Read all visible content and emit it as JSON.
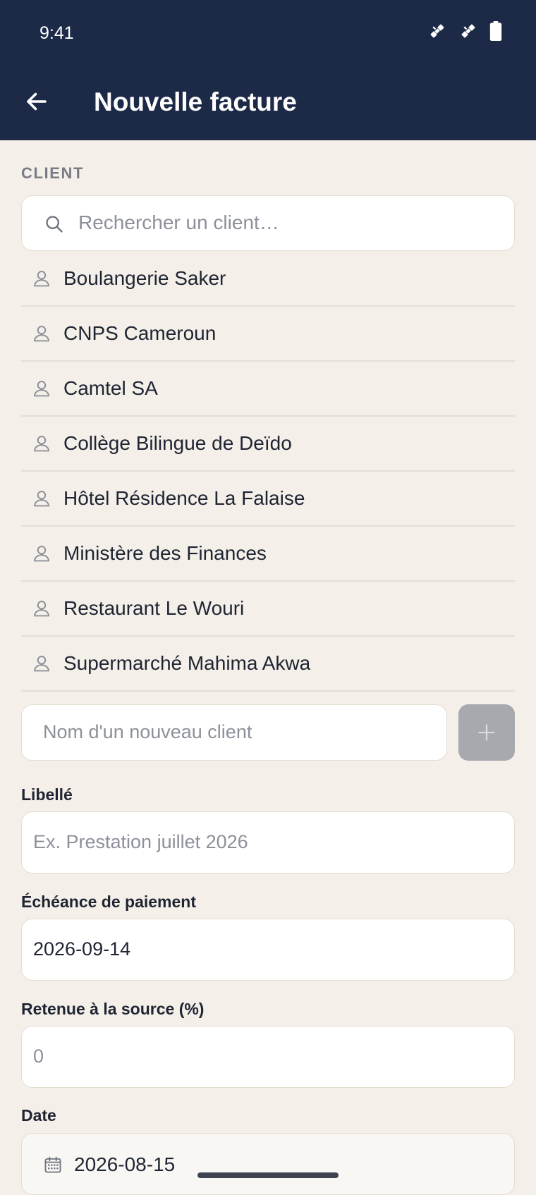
{
  "status_bar": {
    "time": "9:41",
    "icons": [
      "satellite-icon",
      "satellite-icon",
      "battery-icon"
    ]
  },
  "app_bar": {
    "title": "Nouvelle facture",
    "back_icon": "back-arrow-icon"
  },
  "client_section": {
    "label": "CLIENT",
    "search_placeholder": "Rechercher un client…",
    "clients": [
      "Boulangerie Saker",
      "CNPS Cameroun",
      "Camtel SA",
      "Collège Bilingue de Deïdo",
      "Hôtel Résidence La Falaise",
      "Ministère des Finances",
      "Restaurant Le Wouri",
      "Supermarché Mahima Akwa"
    ],
    "new_client_placeholder": "Nom d'un nouveau client",
    "add_icon": "plus-icon"
  },
  "form": {
    "libelle_label": "Libellé",
    "libelle_placeholder": "Ex. Prestation juillet 2026",
    "echeance_label": "Échéance de paiement",
    "echeance_value": "2026-09-14",
    "retenue_label": "Retenue à la source (%)",
    "retenue_placeholder": "0",
    "date_label": "Date",
    "date_value": "2026-08-15"
  },
  "colors": {
    "app_bar": "#1c2a48",
    "background": "#f4efe8",
    "add_button": "#a7a9ae"
  }
}
